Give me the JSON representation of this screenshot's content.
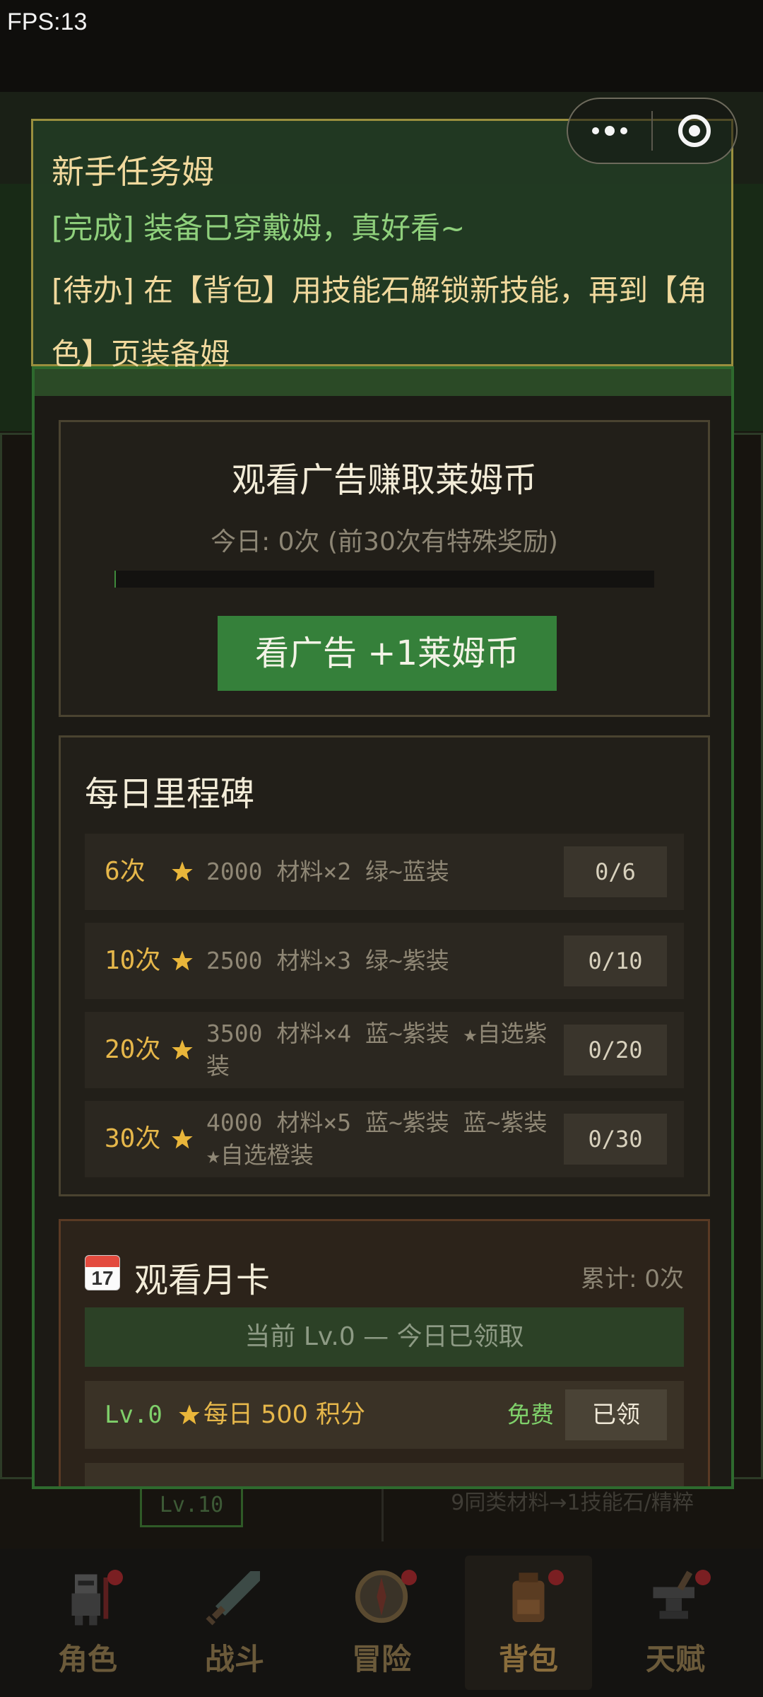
{
  "status": {
    "fps": "FPS:13"
  },
  "background": {
    "level_badge": "Lv.10",
    "hint": "9同类材料→1技能石/精粹"
  },
  "nav": [
    {
      "label": "角色",
      "icon": "knight-icon",
      "badge": true,
      "active": false
    },
    {
      "label": "战斗",
      "icon": "sword-icon",
      "badge": false,
      "active": false
    },
    {
      "label": "冒险",
      "icon": "compass-icon",
      "badge": true,
      "active": false
    },
    {
      "label": "背包",
      "icon": "backpack-icon",
      "badge": true,
      "active": true
    },
    {
      "label": "天赋",
      "icon": "anvil-icon",
      "badge": true,
      "active": false
    }
  ],
  "task": {
    "title": "新手任务姆",
    "done": "[完成] 装备已穿戴姆，真好看~",
    "todo": "[待办] 在【背包】用技能石解锁新技能，再到【角色】页装备姆"
  },
  "ad": {
    "title": "观看广告赚取莱姆币",
    "subtitle": "今日: 0次 (前30次有特殊奖励)",
    "progress": 0,
    "button": "看广告 +1莱姆币"
  },
  "milestones": {
    "title": "每日里程碑",
    "items": [
      {
        "times": "6次",
        "desc": "2000 材料×2 绿~蓝装",
        "progress": "0/6"
      },
      {
        "times": "10次",
        "desc": "2500 材料×3 绿~紫装",
        "progress": "0/10"
      },
      {
        "times": "20次",
        "desc": "3500 材料×4 蓝~紫装 ★自选紫装",
        "progress": "0/20"
      },
      {
        "times": "30次",
        "desc": "4000 材料×5 蓝~紫装 蓝~紫装 ★自选橙装",
        "progress": "0/30"
      }
    ]
  },
  "monthly": {
    "calendar_month": "JUL",
    "calendar_day": "17",
    "title": "观看月卡",
    "total": "累计: 0次",
    "status": "当前 Lv.0 — 今日已领取",
    "rows": [
      {
        "level": "Lv.0",
        "reward": "每日 500 积分",
        "price": "免费",
        "action": "已领"
      }
    ]
  },
  "colors": {
    "accent_green": "#35803a",
    "gold": "#e6b74a",
    "modal_border": "#2e6a2e",
    "task_bg": "#223a24"
  }
}
